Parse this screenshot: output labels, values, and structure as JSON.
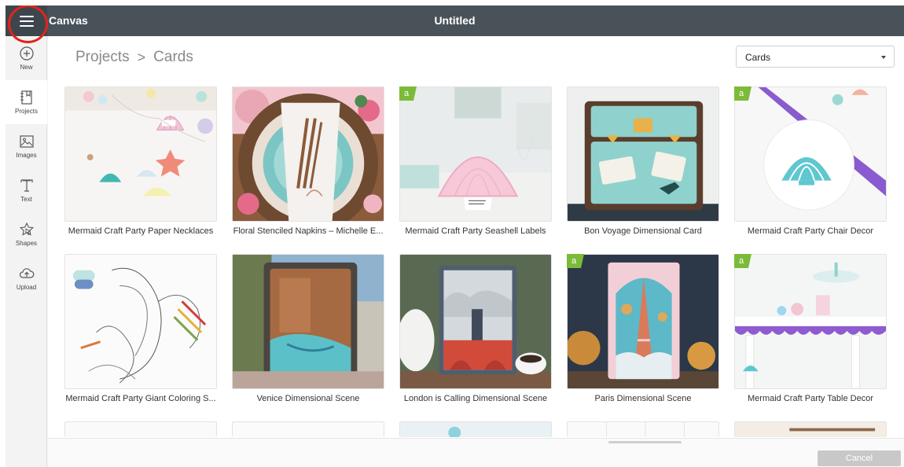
{
  "topbar": {
    "app_title": "Canvas",
    "doc_title": "Untitled",
    "menu_icon": "hamburger-menu-icon"
  },
  "sidebar": {
    "items": [
      {
        "label": "New",
        "icon": "plus-circle-icon"
      },
      {
        "label": "Projects",
        "icon": "projects-icon"
      },
      {
        "label": "Images",
        "icon": "image-icon"
      },
      {
        "label": "Text",
        "icon": "text-icon"
      },
      {
        "label": "Shapes",
        "icon": "shapes-icon"
      },
      {
        "label": "Upload",
        "icon": "upload-cloud-icon"
      }
    ]
  },
  "breadcrumb": {
    "root": "Projects",
    "separator": ">",
    "current": "Cards"
  },
  "category_select": {
    "value": "Cards"
  },
  "projects": [
    {
      "name": "Mermaid Craft Party Paper Necklaces",
      "badge": ""
    },
    {
      "name": "Floral Stenciled Napkins – Michelle E...",
      "badge": ""
    },
    {
      "name": "Mermaid Craft Party Seashell Labels",
      "badge": "a"
    },
    {
      "name": "Bon Voyage Dimensional Card",
      "badge": ""
    },
    {
      "name": "Mermaid Craft Party Chair Decor",
      "badge": "a"
    },
    {
      "name": "Mermaid Craft Party Giant Coloring S...",
      "badge": ""
    },
    {
      "name": "Venice Dimensional Scene",
      "badge": ""
    },
    {
      "name": "London is Calling Dimensional Scene",
      "badge": ""
    },
    {
      "name": "Paris Dimensional Scene",
      "badge": "a"
    },
    {
      "name": "Mermaid Craft Party Table Decor",
      "badge": "a"
    }
  ],
  "footer": {
    "cancel_label": "Cancel"
  },
  "colors": {
    "topbar": "#4a5259",
    "badge": "#7cbb3a",
    "highlight_ring": "#e0251b",
    "cancel_button": "#c8c8c8"
  }
}
